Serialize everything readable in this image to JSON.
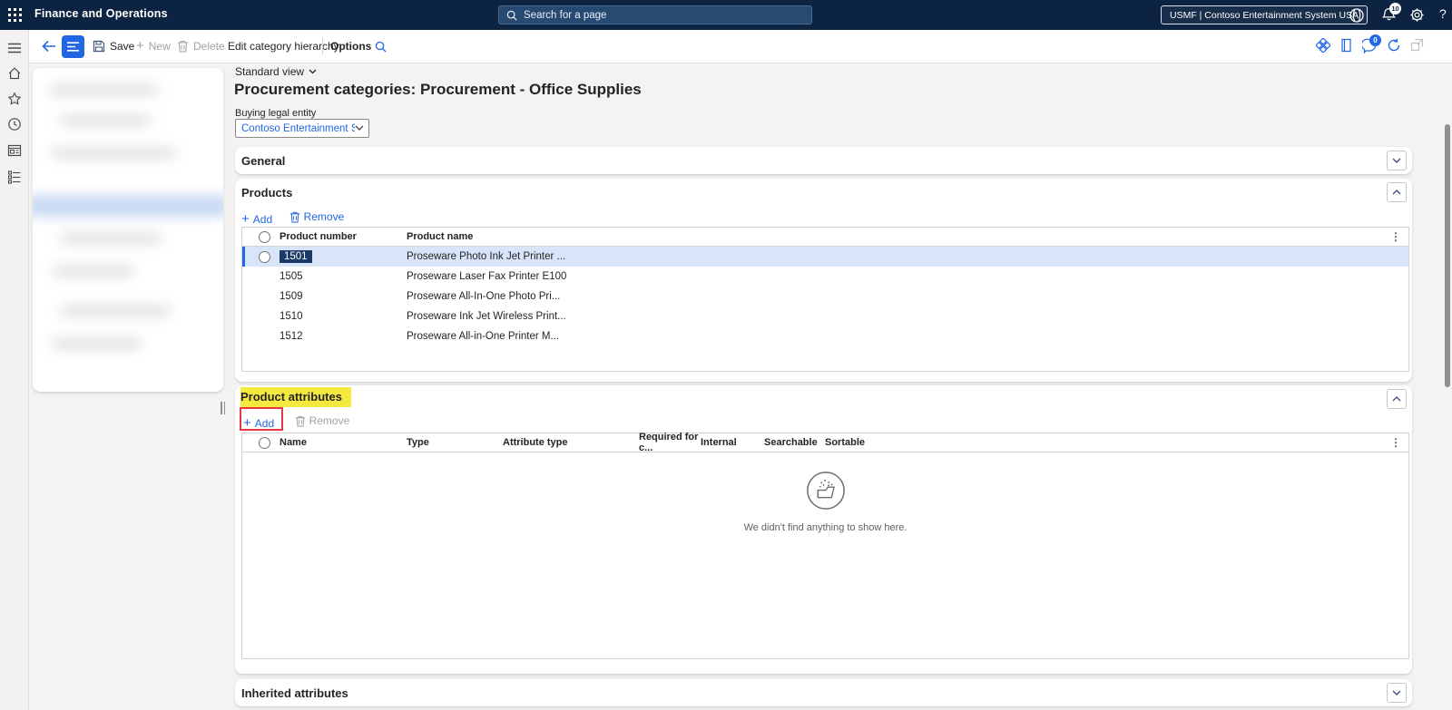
{
  "colors": {
    "accent": "#2266e3",
    "topbar": "#0c2341",
    "annotation_highlight": "#f5e83e",
    "annotation_border": "#e8383f",
    "selected_row": "#d8e4f8",
    "selected_cell": "#1b3a69"
  },
  "topbar": {
    "app_title": "Finance and Operations",
    "search_placeholder": "Search for a page",
    "environment": "USMF | Contoso Entertainment System USA",
    "notification_count": "10",
    "help_label": "?"
  },
  "action_bar": {
    "save": "Save",
    "new": "New",
    "delete": "Delete",
    "edit_hierarchy": "Edit category hierarchy",
    "options": "Options",
    "message_badge": "0"
  },
  "page": {
    "view_selector": "Standard view",
    "title": "Procurement categories: Procurement - Office Supplies",
    "buying_legal_entity_label": "Buying legal entity",
    "buying_legal_entity_value": "Contoso Entertainment Syste..."
  },
  "sections": {
    "general": {
      "title": "General"
    },
    "products": {
      "title": "Products",
      "toolbar": {
        "add": "Add",
        "remove": "Remove"
      },
      "columns": [
        "Product number",
        "Product name"
      ],
      "rows": [
        {
          "number": "1501",
          "name": "Proseware Photo Ink Jet Printer ..."
        },
        {
          "number": "1505",
          "name": "Proseware Laser Fax Printer E100"
        },
        {
          "number": "1509",
          "name": "Proseware All-In-One Photo Pri..."
        },
        {
          "number": "1510",
          "name": "Proseware Ink Jet Wireless  Print..."
        },
        {
          "number": "1512",
          "name": "Proseware All-in-One Printer M..."
        }
      ]
    },
    "product_attributes": {
      "title": "Product attributes",
      "toolbar": {
        "add": "Add",
        "remove": "Remove"
      },
      "columns": [
        "Name",
        "Type",
        "Attribute type",
        "Required for c...",
        "Internal",
        "Searchable",
        "Sortable"
      ],
      "empty_message": "We didn't find anything to show here."
    },
    "inherited_attributes": {
      "title": "Inherited attributes"
    }
  }
}
